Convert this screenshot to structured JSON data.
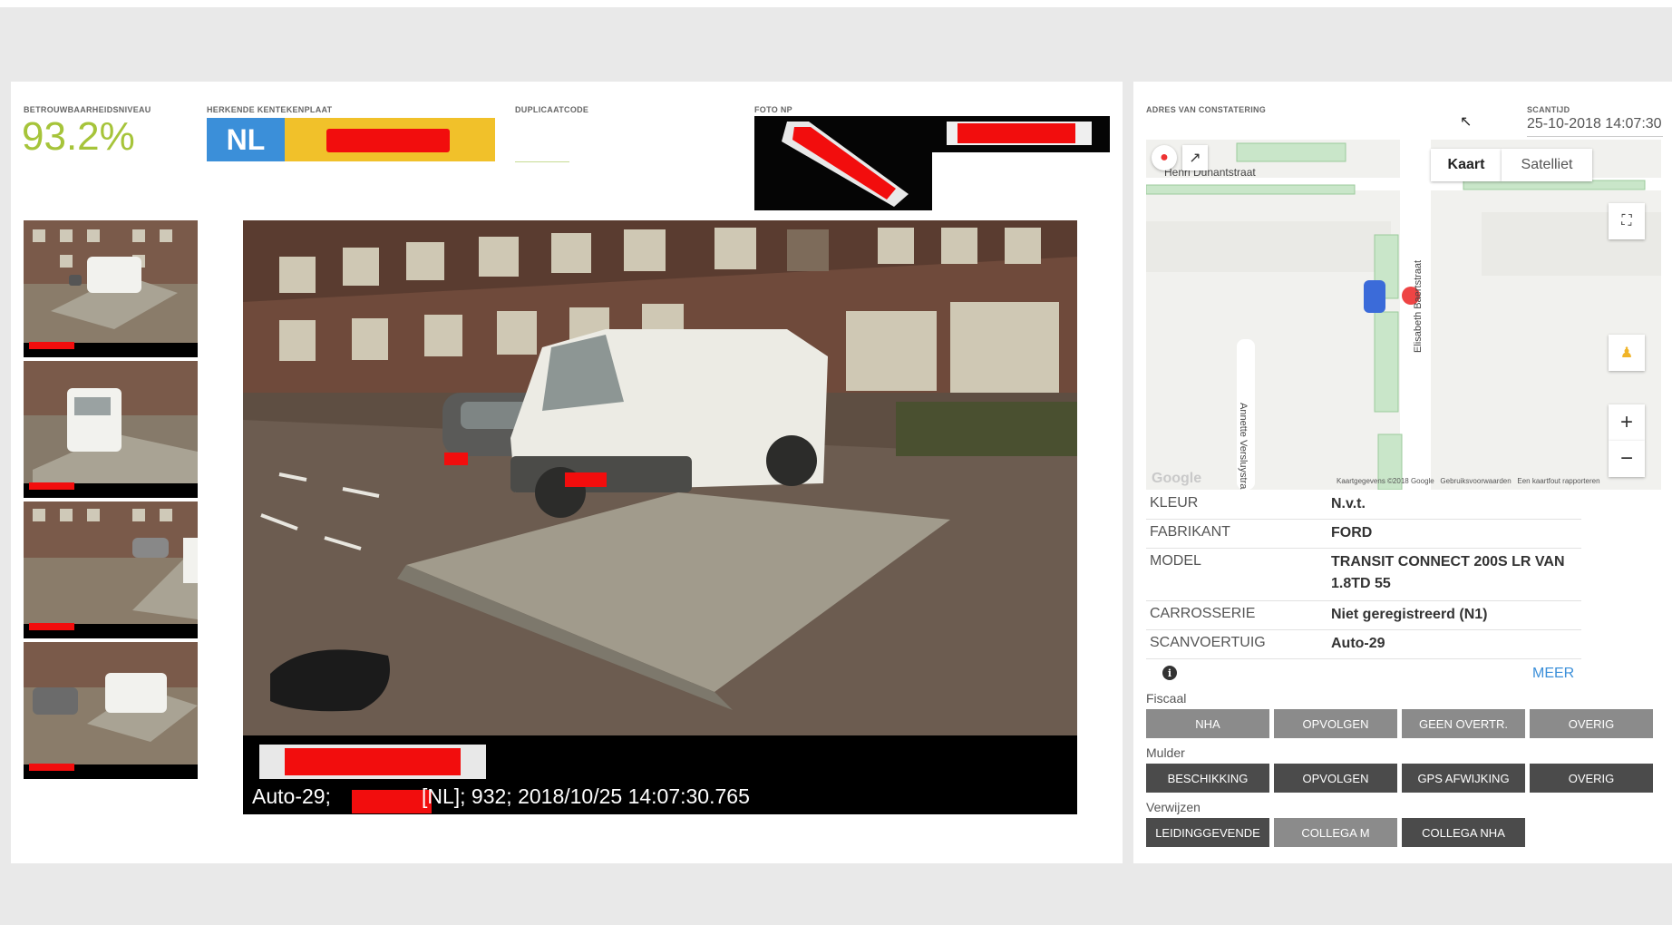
{
  "reliability": {
    "label": "BETROUWBAARHEIDSNIVEAU",
    "value": "93.2%"
  },
  "plate": {
    "label": "HERKENDE KENTEKENPLAAT",
    "country": "NL"
  },
  "duplicate": {
    "label": "DUPLICAATCODE"
  },
  "photo_np": {
    "label": "FOTO NP"
  },
  "main_photo": {
    "caption_prefix": "Auto-29;",
    "caption_suffix": "[NL]; 932; 2018/10/25 14:07:30.765"
  },
  "address": {
    "label": "ADRES VAN CONSTATERING"
  },
  "scan_time": {
    "label": "SCANTIJD",
    "value": "25-10-2018 14:07:30"
  },
  "map": {
    "tab_map": "Kaart",
    "tab_satellite": "Satelliet",
    "streets": [
      "Henri Dunantstraat",
      "Elisabeth Baertstraat",
      "Annette Versluystra"
    ],
    "attribution": [
      "Kaartgegevens ©2018 Google",
      "Gebruiksvoorwaarden",
      "Een kaartfout rapporteren"
    ],
    "logo": "Google"
  },
  "vehicle": [
    {
      "key": "KLEUR",
      "value": "N.v.t."
    },
    {
      "key": "FABRIKANT",
      "value": "FORD"
    },
    {
      "key": "MODEL",
      "value": "TRANSIT CONNECT 200S LR VAN 1.8TD 55"
    },
    {
      "key": "CARROSSERIE",
      "value": "Niet geregistreerd (N1)"
    },
    {
      "key": "SCANVOERTUIG",
      "value": "Auto-29"
    }
  ],
  "more_link": "MEER",
  "groups": {
    "fiscaal": {
      "label": "Fiscaal",
      "buttons": [
        "NHA",
        "OPVOLGEN",
        "GEEN OVERTR.",
        "OVERIG"
      ]
    },
    "mulder": {
      "label": "Mulder",
      "buttons": [
        "BESCHIKKING",
        "OPVOLGEN",
        "GPS AFWIJKING",
        "OVERIG"
      ]
    },
    "verwijzen": {
      "label": "Verwijzen",
      "buttons": [
        "LEIDINGGEVENDE",
        "COLLEGA M",
        "COLLEGA NHA"
      ]
    }
  },
  "colors": {
    "accent_green": "#a6c43a",
    "plate_blue": "#3b8fd9",
    "plate_yellow": "#f1c12a",
    "button_dark": "#4b4b4b",
    "button_light": "#8b8b8b",
    "link_blue": "#3b8fd9"
  }
}
